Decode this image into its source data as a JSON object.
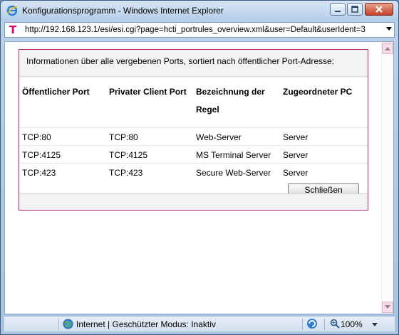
{
  "window": {
    "title": "Konfigurationsprogramm - Windows Internet Explorer",
    "icon": "ie-icon"
  },
  "address": {
    "url": "http://192.168.123.1/esi/esi.cgi?page=hcti_portrules_overview.xml&user=Default&userIdent=3",
    "site_logo": "T"
  },
  "panel": {
    "intro": "Informationen über alle vergebenen Ports, sortiert nach öffentlicher Port-Adresse:",
    "columns": [
      "Öffentlicher Port",
      "Privater Client Port",
      "Bezeichnung der",
      "Zugeordneter PC"
    ],
    "column3_line2": "Regel",
    "rows": [
      {
        "public": "TCP:80",
        "private": "TCP:80",
        "name": "Web-Server",
        "pc": "Server"
      },
      {
        "public": "TCP:4125",
        "private": "TCP:4125",
        "name": "MS Terminal Server",
        "pc": "Server"
      },
      {
        "public": "TCP:423",
        "private": "TCP:423",
        "name": "Secure Web-Server",
        "pc": "Server"
      }
    ],
    "close_label": "Schließen"
  },
  "status": {
    "zone_text": "Internet | Geschützter Modus: Inaktiv",
    "zoom": "100%"
  },
  "colors": {
    "panel_border": "#b3246e",
    "telekom_magenta": "#e20074"
  }
}
